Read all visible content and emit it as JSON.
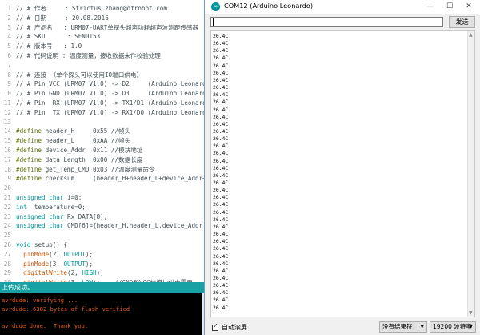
{
  "editor": {
    "lines": [
      {
        "n": "1",
        "segs": [
          {
            "t": "// # 作者     : Strictus.zhang@dfrobot.com",
            "c": "c-cm"
          }
        ]
      },
      {
        "n": "2",
        "segs": [
          {
            "t": "// # 日期     : 20.08.2016",
            "c": "c-cm"
          }
        ]
      },
      {
        "n": "3",
        "segs": [
          {
            "t": "// # 产品名   : URM07-UART单探头超声功耗超声波测距传感器",
            "c": "c-cm"
          }
        ]
      },
      {
        "n": "4",
        "segs": [
          {
            "t": "// # SKU      : SEN0153",
            "c": "c-cm"
          }
        ]
      },
      {
        "n": "5",
        "segs": [
          {
            "t": "// # 版本号   : 1.0",
            "c": "c-cm"
          }
        ]
      },
      {
        "n": "6",
        "segs": [
          {
            "t": "// # 代码说明 : 温度测量，接收数据未作校验处理",
            "c": "c-cm"
          }
        ]
      },
      {
        "n": "7",
        "segs": [
          {
            "t": "",
            "c": "c-cm"
          }
        ]
      },
      {
        "n": "8",
        "segs": [
          {
            "t": "// # 连接 （单个探头可以使用IO端口供电）",
            "c": "c-cm"
          }
        ]
      },
      {
        "n": "9",
        "segs": [
          {
            "t": "// # Pin VCC (URM07 V1.0) -> D2     (Arduino Leonardo)",
            "c": "c-cm"
          }
        ]
      },
      {
        "n": "10",
        "segs": [
          {
            "t": "// # Pin GND (URM07 V1.0) -> D3     (Arduino Leonardo)",
            "c": "c-cm"
          }
        ]
      },
      {
        "n": "11",
        "segs": [
          {
            "t": "// # Pin  RX (URM07 V1.0) -> TX1/D1 (Arduino Leonardo)",
            "c": "c-cm"
          }
        ]
      },
      {
        "n": "12",
        "segs": [
          {
            "t": "// # Pin  TX (URM07 V1.0) -> RX1/D0 (Arduino Leonardo)",
            "c": "c-cm"
          }
        ]
      },
      {
        "n": "13",
        "segs": [
          {
            "t": "",
            "c": "c-cm"
          }
        ]
      },
      {
        "n": "14",
        "segs": [
          {
            "t": "#define",
            "c": "c-pp"
          },
          {
            "t": " header_H     0x55 //帧头",
            "c": "c-cm"
          }
        ]
      },
      {
        "n": "15",
        "segs": [
          {
            "t": "#define",
            "c": "c-pp"
          },
          {
            "t": " header_L     0xAA //帧头",
            "c": "c-cm"
          }
        ]
      },
      {
        "n": "16",
        "segs": [
          {
            "t": "#define",
            "c": "c-pp"
          },
          {
            "t": " device_Addr  0x11 //模块地址",
            "c": "c-cm"
          }
        ]
      },
      {
        "n": "17",
        "segs": [
          {
            "t": "#define",
            "c": "c-pp"
          },
          {
            "t": " data_Length  0x00 //数据长度",
            "c": "c-cm"
          }
        ]
      },
      {
        "n": "18",
        "segs": [
          {
            "t": "#define",
            "c": "c-pp"
          },
          {
            "t": " get_Temp_CMD 0x03 //温度测量命令",
            "c": "c-cm"
          }
        ]
      },
      {
        "n": "19",
        "segs": [
          {
            "t": "#define",
            "c": "c-pp"
          },
          {
            "t": " checksum     (header_H+header_L+device_Addr+data_Length+get",
            "c": "c-cm"
          }
        ]
      },
      {
        "n": "20",
        "segs": [
          {
            "t": "",
            "c": "c-cm"
          }
        ]
      },
      {
        "n": "21",
        "segs": [
          {
            "t": "unsigned char",
            "c": "c-kw"
          },
          {
            "t": " i=0;",
            "c": "c-cm"
          }
        ]
      },
      {
        "n": "22",
        "segs": [
          {
            "t": "int",
            "c": "c-kw"
          },
          {
            "t": "  temperature=0;",
            "c": "c-cm"
          }
        ]
      },
      {
        "n": "23",
        "segs": [
          {
            "t": "unsigned char",
            "c": "c-kw"
          },
          {
            "t": " Rx_DATA[8];",
            "c": "c-cm"
          }
        ]
      },
      {
        "n": "24",
        "segs": [
          {
            "t": "unsigned char",
            "c": "c-kw"
          },
          {
            "t": " CMD[6]={header_H,header_L,device_Addr,data_Length,get",
            "c": "c-cm"
          }
        ]
      },
      {
        "n": "25",
        "segs": [
          {
            "t": "",
            "c": "c-cm"
          }
        ]
      },
      {
        "n": "26",
        "segs": [
          {
            "t": "void",
            "c": "c-kw"
          },
          {
            "t": " setup() {",
            "c": "c-cm"
          }
        ]
      },
      {
        "n": "27",
        "segs": [
          {
            "t": "  pinMode",
            "c": "c-fn"
          },
          {
            "t": "(2, ",
            "c": "c-cm"
          },
          {
            "t": "OUTPUT",
            "c": "c-kw"
          },
          {
            "t": ");",
            "c": "c-cm"
          }
        ]
      },
      {
        "n": "28",
        "segs": [
          {
            "t": "  pinMode",
            "c": "c-fn"
          },
          {
            "t": "(3, ",
            "c": "c-cm"
          },
          {
            "t": "OUTPUT",
            "c": "c-kw"
          },
          {
            "t": ");",
            "c": "c-cm"
          }
        ]
      },
      {
        "n": "29",
        "segs": [
          {
            "t": "  digitalWrite",
            "c": "c-fn"
          },
          {
            "t": "(2, ",
            "c": "c-cm"
          },
          {
            "t": "HIGH",
            "c": "c-kw"
          },
          {
            "t": ");",
            "c": "c-cm"
          }
        ]
      },
      {
        "n": "30",
        "segs": [
          {
            "t": "  digitalWrite",
            "c": "c-fn"
          },
          {
            "t": "(3, ",
            "c": "c-cm"
          },
          {
            "t": "LOW",
            "c": "c-kw"
          },
          {
            "t": ");    //GND和VCC给模块供电需要",
            "c": "c-cm"
          }
        ]
      }
    ]
  },
  "status": {
    "text": "上传成功。"
  },
  "console": {
    "lines": [
      "avrdude: verifying ...",
      "avrdude: 6382 bytes of flash verified",
      "",
      "avrdude done.  Thank you."
    ]
  },
  "monitor": {
    "title": "COM12 (Arduino Leonardo)",
    "input_value": "",
    "send_label": "发送",
    "output_lines": [
      "26.4C",
      "26.4C",
      "26.4C",
      "26.4C",
      "26.4C",
      "26.4C",
      "26.4C",
      "26.4C",
      "26.4C",
      "26.4C",
      "26.4C",
      "26.4C",
      "26.4C",
      "26.4C",
      "26.4C",
      "26.4C",
      "26.4C",
      "26.4C",
      "26.4C",
      "26.4C",
      "26.4C",
      "26.4C",
      "26.4C",
      "26.4C",
      "26.4C",
      "26.4C",
      "26.4C",
      "26.4C",
      "26.4C",
      "26.4C",
      "26.4C",
      "26.4C",
      "26.4C",
      "26.4C",
      "26.4C",
      "26.4C",
      "26.4C",
      "26.4C"
    ],
    "autoscroll_label": "自动滚屏",
    "autoscroll_checked": true,
    "line_ending": "没有结束符",
    "baud": "19200 波特率",
    "minimize_glyph": "—",
    "maximize_glyph": "☐",
    "close_glyph": "✕"
  },
  "colors": {
    "accent": "#00979c",
    "console_text": "#e25c1a",
    "status_bar": "#17a1a5"
  }
}
